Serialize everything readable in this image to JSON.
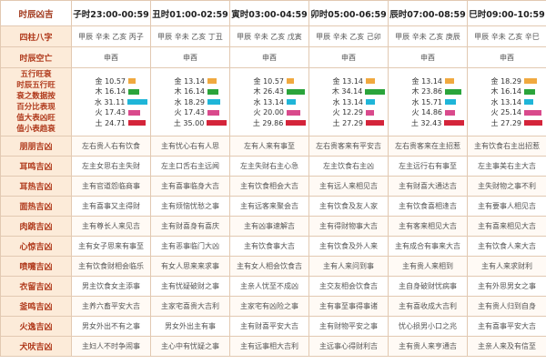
{
  "corner": "时辰凶吉",
  "hours": [
    "子时23:00-00:59",
    "丑时01:00-02:59",
    "寅时03:00-04:59",
    "卯时05:00-06:59",
    "辰时07:00-08:59",
    "巳时09:00-10:59"
  ],
  "rows": {
    "sizhu": {
      "label": "四柱八字",
      "values": [
        "甲辰 辛未 乙亥 丙子",
        "甲辰 辛未 乙亥 丁丑",
        "甲辰 辛未 乙亥 戊寅",
        "甲辰 辛未 乙亥 己卯",
        "甲辰 辛未 乙亥 庚辰",
        "甲辰 辛未 乙亥 辛巳"
      ]
    },
    "kongwang": {
      "label": "时辰空亡",
      "values": [
        "申酉",
        "申酉",
        "申酉",
        "申酉",
        "申酉",
        "申酉"
      ]
    },
    "wuxing_label_lines": [
      "五行旺衰",
      "时辰五行旺",
      "衰之数据按",
      "百分比表现",
      "值大表凶旺",
      "值小表趋衰"
    ],
    "colors": {
      "金": "#f0a93f",
      "木": "#2aa43b",
      "水": "#1fb5d8",
      "火": "#d94a8c",
      "土": "#d4243a"
    },
    "wuxing": [
      [
        [
          "金",
          "10.57"
        ],
        [
          "木",
          "16.14"
        ],
        [
          "水",
          "31.11"
        ],
        [
          "火",
          "17.43"
        ],
        [
          "土",
          "24.71"
        ]
      ],
      [
        [
          "金",
          "13.14"
        ],
        [
          "木",
          "16.14"
        ],
        [
          "水",
          "18.29"
        ],
        [
          "火",
          "17.43"
        ],
        [
          "土",
          "35.00"
        ]
      ],
      [
        [
          "金",
          "10.57"
        ],
        [
          "木",
          "26.43"
        ],
        [
          "水",
          "13.14"
        ],
        [
          "火",
          "20.00"
        ],
        [
          "土",
          "29.86"
        ]
      ],
      [
        [
          "金",
          "13.14"
        ],
        [
          "木",
          "34.14"
        ],
        [
          "水",
          "13.14"
        ],
        [
          "火",
          "12.29"
        ],
        [
          "土",
          "27.29"
        ]
      ],
      [
        [
          "金",
          "13.14"
        ],
        [
          "木",
          "23.86"
        ],
        [
          "水",
          "15.71"
        ],
        [
          "火",
          "14.86"
        ],
        [
          "土",
          "32.43"
        ]
      ],
      [
        [
          "金",
          "18.29"
        ],
        [
          "木",
          "16.14"
        ],
        [
          "水",
          "13.14"
        ],
        [
          "火",
          "25.14"
        ],
        [
          "土",
          "27.29"
        ]
      ]
    ],
    "jixiong": [
      {
        "label": "朋朋吉凶",
        "values": [
          "左右贵人右有饮食",
          "主有忧心右有人思",
          "左有人来有事至",
          "左右贵客来有平安吉",
          "左右贵客来在主招惹",
          "主有饮食右主出招惹"
        ]
      },
      {
        "label": "耳鸣吉凶",
        "values": [
          "左主女思右主失财",
          "左主口舌右主远闻",
          "左主失财右主心急",
          "左主饮食右主凶",
          "左主远行右有事至",
          "左主事美右主大吉"
        ]
      },
      {
        "label": "耳热吉凶",
        "values": [
          "主有官道怨临商事",
          "主有喜事临身大吉",
          "主有饮食相会大吉",
          "主有远人来相见吉",
          "主有财喜大通达吉",
          "主失财物之事不利"
        ]
      },
      {
        "label": "面热吉凶",
        "values": [
          "主有喜事又主得财",
          "主有烦恼忧愁之事",
          "主有远客来聚会吉",
          "主有饮食及友人家",
          "主有饮食喜相逢吉",
          "主有要事人相见吉"
        ]
      },
      {
        "label": "肉跳吉凶",
        "values": [
          "主有尊长人来见吉",
          "主有财喜身有喜庆",
          "主有凶事速解吉",
          "主有得财物事大吉",
          "主有客来相见大吉",
          "主有喜来相见大吉"
        ]
      },
      {
        "label": "心惊吉凶",
        "values": [
          "主有女子思来有事至",
          "主有恶事临门大凶",
          "主有饮食事大吉",
          "主有饮食及外人来",
          "主有成合有事来大吉",
          "主有饮食人来大吉"
        ]
      },
      {
        "label": "喷嚏吉凶",
        "values": [
          "主有饮食财相会临乐",
          "有女人思来来求事",
          "主有女人相会饮食吉",
          "主有人来问到事",
          "主有贵人来相到",
          "主有人来求财利"
        ]
      },
      {
        "label": "衣留吉凶",
        "values": [
          "男主饮食女主添事",
          "主有忧疑破财之事",
          "主亲人忧至不成凶",
          "主交友相会饮食吉",
          "主自身破财忧病事",
          "主有外思男女之事"
        ]
      },
      {
        "label": "釜鸣吉凶",
        "values": [
          "主养六畜平安大吉",
          "主家宅喜贵大吉利",
          "主家宅有凶险之事",
          "主有事至事得事诸",
          "主有喜收成大吉利",
          "主有贵人归到自身"
        ]
      },
      {
        "label": "火逸吉凶",
        "values": [
          "男女外出不有之事",
          "男女外出主有事",
          "主有财喜平安大吉",
          "主有财物平安之事",
          "忧心损男小口之兆",
          "主有喜事平安大吉"
        ]
      },
      {
        "label": "犬吠吉凶",
        "values": [
          "主妇人不时争闹事",
          "主心中有忧疑之事",
          "主有远事相大吉利",
          "主远事心得财利吉",
          "主有贵人来亨通吉",
          "主亲人来及有信至"
        ]
      }
    ]
  }
}
